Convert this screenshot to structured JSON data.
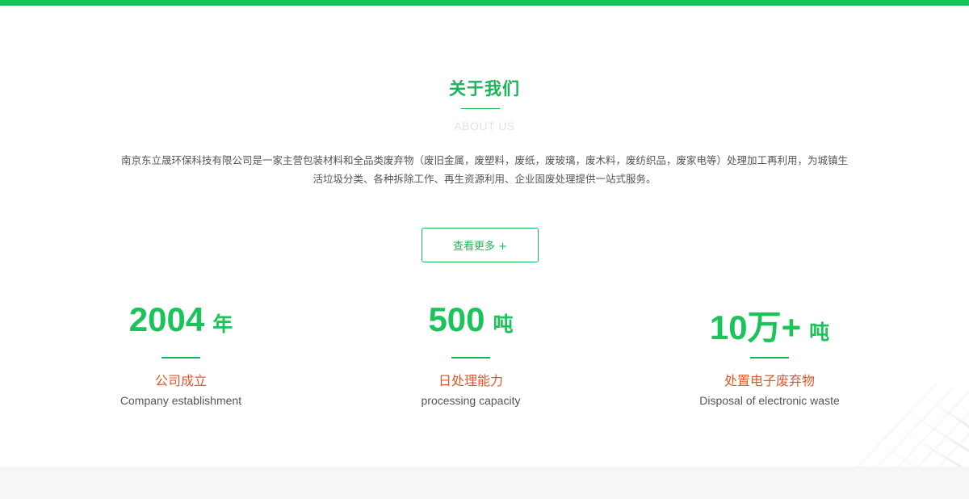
{
  "about": {
    "title": "关于我们",
    "subtitle": "ABOUT US",
    "description": "南京东立晟环保科技有限公司是一家主营包装材料和全品类废弃物（废旧金属，废塑料，废纸，废玻璃，废木料，废纺织品，废家电等）处理加工再利用，为城镇生活垃圾分类、各种拆除工作、再生资源利用、企业固废处理提供一站式服务。",
    "more_label": "查看更多 +"
  },
  "stats": [
    {
      "number": "2004",
      "unit": "年",
      "label_cn": "公司成立",
      "label_en": "Company establishment"
    },
    {
      "number": "500",
      "unit": "吨",
      "label_cn": "日处理能力",
      "label_en": "processing capacity"
    },
    {
      "number": "10万+",
      "unit": "吨",
      "label_cn": "处置电子废弃物",
      "label_en": "Disposal of electronic waste"
    }
  ],
  "colors": {
    "accent_green": "#1bc45a",
    "highlight_orange": "#e0582a",
    "text_gray": "#555555",
    "footer_band": "#f6f6f4"
  }
}
